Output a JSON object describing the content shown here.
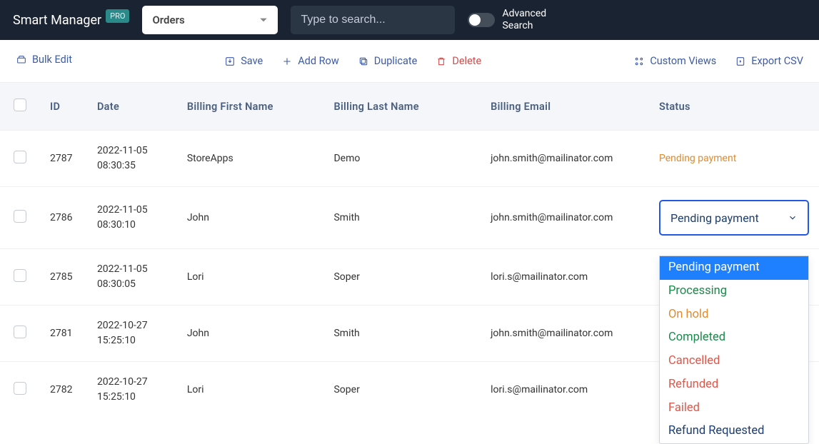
{
  "header": {
    "brand": "Smart Manager",
    "badge": "PRO",
    "entity_select": "Orders",
    "search_placeholder": "Type to search...",
    "advanced_line1": "Advanced",
    "advanced_line2": "Search"
  },
  "toolbar": {
    "bulk_edit": "Bulk Edit",
    "save": "Save",
    "add_row": "Add Row",
    "duplicate": "Duplicate",
    "delete": "Delete",
    "custom_views": "Custom Views",
    "export_csv": "Export CSV"
  },
  "columns": {
    "id": "ID",
    "date": "Date",
    "fname": "Billing First Name",
    "lname": "Billing Last Name",
    "email": "Billing Email",
    "status": "Status"
  },
  "rows": [
    {
      "id": "2787",
      "date1": "2022-11-05",
      "date2": "08:30:35",
      "fname": "StoreApps",
      "lname": "Demo",
      "email": "john.smith@mailinator.com",
      "status_text": "Pending payment",
      "status_mode": "text"
    },
    {
      "id": "2786",
      "date1": "2022-11-05",
      "date2": "08:30:10",
      "fname": "John",
      "lname": "Smith",
      "email": "john.smith@mailinator.com",
      "status_text": "Pending payment",
      "status_mode": "dropdown"
    },
    {
      "id": "2785",
      "date1": "2022-11-05",
      "date2": "08:30:05",
      "fname": "Lori",
      "lname": "Soper",
      "email": "lori.s@mailinator.com",
      "status_text": "",
      "status_mode": "none"
    },
    {
      "id": "2781",
      "date1": "2022-10-27",
      "date2": "15:25:10",
      "fname": "John",
      "lname": "Smith",
      "email": "john.smith@mailinator.com",
      "status_text": "",
      "status_mode": "none"
    },
    {
      "id": "2782",
      "date1": "2022-10-27",
      "date2": "15:25:10",
      "fname": "Lori",
      "lname": "Soper",
      "email": "lori.s@mailinator.com",
      "status_text": "",
      "status_mode": "none"
    }
  ],
  "status_options": [
    {
      "label": "Pending payment",
      "cls": "c-pend",
      "selected": true
    },
    {
      "label": "Processing",
      "cls": "c-proc",
      "selected": false
    },
    {
      "label": "On hold",
      "cls": "c-hold",
      "selected": false
    },
    {
      "label": "Completed",
      "cls": "c-comp",
      "selected": false
    },
    {
      "label": "Cancelled",
      "cls": "c-canc",
      "selected": false
    },
    {
      "label": "Refunded",
      "cls": "c-refu",
      "selected": false
    },
    {
      "label": "Failed",
      "cls": "c-fail",
      "selected": false
    },
    {
      "label": "Refund Requested",
      "cls": "c-rreq",
      "selected": false
    }
  ]
}
